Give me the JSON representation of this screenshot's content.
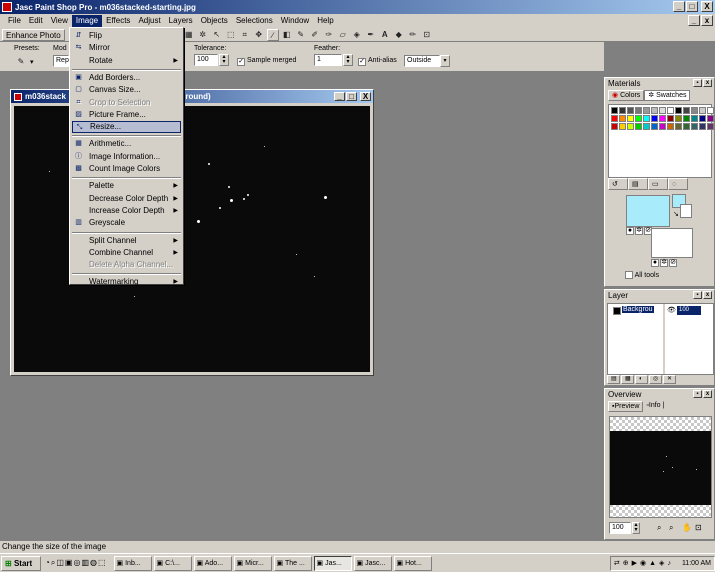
{
  "app": {
    "title": "Jasc Paint Shop Pro - m036stacked-starting.jpg",
    "caption_buttons": [
      "_",
      "□",
      "X"
    ]
  },
  "menubar": {
    "items": [
      "File",
      "Edit",
      "View",
      "Image",
      "Effects",
      "Adjust",
      "Layers",
      "Objects",
      "Selections",
      "Window",
      "Help"
    ]
  },
  "toolbar": {
    "enhance_photo": "Enhance Photo"
  },
  "options": {
    "presets_label": "Presets:",
    "mode_label": "Mod",
    "mode_value": "Repl",
    "tolerance_label": "Tolerance:",
    "tolerance_value": "100",
    "sample_merged": "Sample merged",
    "feather_label": "Feather:",
    "feather_value": "1",
    "antialias": "Anti-alias",
    "antialias_mode": "Outside"
  },
  "image_window": {
    "title_left": "m036stack",
    "title_right": "kground)",
    "buttons": [
      "_",
      "□",
      "X"
    ]
  },
  "image_menu": {
    "items": [
      {
        "label": "Flip",
        "icon": "flip-icon",
        "disabled": false,
        "submenu": false
      },
      {
        "label": "Mirror",
        "icon": "mirror-icon",
        "disabled": false,
        "submenu": false
      },
      {
        "label": "Rotate",
        "icon": "",
        "disabled": false,
        "submenu": true
      },
      {
        "sep": true
      },
      {
        "label": "Add Borders...",
        "icon": "border-icon",
        "disabled": false,
        "submenu": false
      },
      {
        "label": "Canvas Size...",
        "icon": "canvas-icon",
        "disabled": false,
        "submenu": false
      },
      {
        "label": "Crop to Selection",
        "icon": "crop-icon",
        "disabled": true,
        "submenu": false
      },
      {
        "label": "Picture Frame...",
        "icon": "frame-icon",
        "disabled": false,
        "submenu": false
      },
      {
        "label": "Resize...",
        "icon": "resize-icon",
        "disabled": false,
        "submenu": false,
        "highlight": true
      },
      {
        "sep": true
      },
      {
        "label": "Arithmetic...",
        "icon": "arithmetic-icon",
        "disabled": false,
        "submenu": false
      },
      {
        "label": "Image Information...",
        "icon": "info-icon",
        "disabled": false,
        "submenu": false
      },
      {
        "label": "Count Image Colors",
        "icon": "count-icon",
        "disabled": false,
        "submenu": false
      },
      {
        "sep": true
      },
      {
        "label": "Palette",
        "icon": "",
        "disabled": false,
        "submenu": true
      },
      {
        "label": "Decrease Color Depth",
        "icon": "",
        "disabled": false,
        "submenu": true
      },
      {
        "label": "Increase Color Depth",
        "icon": "",
        "disabled": false,
        "submenu": true
      },
      {
        "label": "Greyscale",
        "icon": "greyscale-icon",
        "disabled": false,
        "submenu": false
      },
      {
        "sep": true
      },
      {
        "label": "Split Channel",
        "icon": "",
        "disabled": false,
        "submenu": true
      },
      {
        "label": "Combine Channel",
        "icon": "",
        "disabled": false,
        "submenu": true
      },
      {
        "label": "Delete Alpha Channel...",
        "icon": "",
        "disabled": true,
        "submenu": false
      },
      {
        "sep": true
      },
      {
        "label": "Watermarking",
        "icon": "",
        "disabled": false,
        "submenu": true
      }
    ]
  },
  "materials": {
    "title": "Materials",
    "tab_colors": "Colors",
    "tab_swatches": "Swatches",
    "all_tools": "All tools",
    "fg_color": "#a8ecfc",
    "bg_color": "#ffffff"
  },
  "layer": {
    "title": "Layer",
    "layer_name": "Backgrou",
    "opacity": "100"
  },
  "overview": {
    "title": "Overview",
    "tab_preview": "Preview",
    "tab_info": "Info",
    "zoom": "100"
  },
  "status": {
    "text": "Change the size of the image"
  },
  "taskbar": {
    "start": "Start",
    "tasks": [
      "Inb...",
      "C:\\...",
      "Ado...",
      "Micr...",
      "The ...",
      "Jas...",
      "Jasc...",
      "Hot..."
    ],
    "pressed_index": 5,
    "clock": "11:00 AM"
  }
}
